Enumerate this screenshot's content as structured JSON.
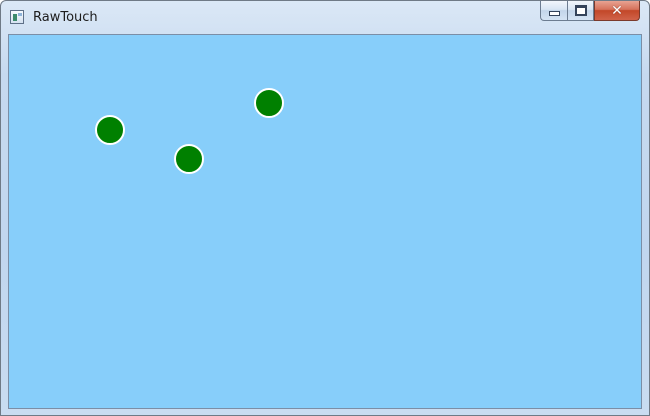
{
  "window": {
    "title": "RawTouch",
    "close_glyph": "✕",
    "background_color": "#87cefa",
    "touch_point_color": "#008000",
    "touch_point_stroke": "#ffffff",
    "touch_point_count": 3
  }
}
